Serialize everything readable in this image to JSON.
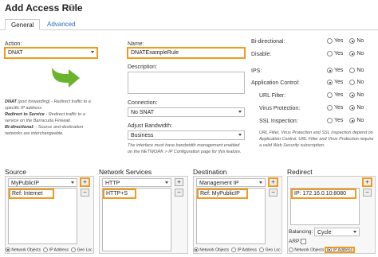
{
  "header": {
    "title": "Add Access Rule",
    "help_icon": "?"
  },
  "tabs": [
    {
      "label": "General"
    },
    {
      "label": "Advanced"
    }
  ],
  "action": {
    "label": "Action:",
    "value": "DNAT",
    "help": {
      "dnat_term": "DNAT",
      "dnat_desc": "(port forwarding) - Redirect traffic to a specific IP address.",
      "redirect_term": "Redirect to Service",
      "redirect_desc": " - Redirect traffic to a service on the Barracuda Firewall.",
      "bidi_term": "Bi-directional:",
      "bidi_desc": " - Source and destination networks are interchangeable."
    },
    "arrow_color": "#6ab42d"
  },
  "name": {
    "label": "Name:",
    "value": "DNATExampleRule"
  },
  "description": {
    "label": "Description:"
  },
  "connection": {
    "label": "Connection:",
    "value": "No SNAT"
  },
  "bandwidth": {
    "label": "Adjust Bandwidth:",
    "value": "Business",
    "help": "The interface must have bandwidth management enabled on the NETWORK > IP Configuration page for this feature."
  },
  "options": {
    "bidirectional": {
      "label": "Bi-directional:",
      "yes": "Yes",
      "no": "No",
      "selected": "no"
    },
    "disable": {
      "label": "Disable:",
      "yes": "Yes",
      "no": "No",
      "selected": "no"
    },
    "ips": {
      "label": "IPS:",
      "yes": "Yes",
      "no": "No",
      "selected": "yes"
    },
    "app_control": {
      "label": "Application Control:",
      "yes": "Yes",
      "no": "No",
      "selected": "yes"
    },
    "url_filter": {
      "label": "URL Filter:",
      "yes": "Yes",
      "no": "No",
      "selected": "no"
    },
    "virus_protection": {
      "label": "Virus Protection:",
      "yes": "Yes",
      "no": "No",
      "selected": "no"
    },
    "ssl_inspection": {
      "label": "SSL Inspection:",
      "yes": "Yes",
      "no": "No",
      "selected": "no"
    },
    "note": "URL Filter, Virus Protection and SSL Inspection depend on Application Control. URL Filter and Virus Protection require a valid Web Security subscription."
  },
  "source": {
    "title": "Source",
    "select_value": "MyPublicIP",
    "list": [
      "Ref: Internet"
    ],
    "footer": [
      "Network Objects",
      "IP Address",
      "Geo Loc"
    ]
  },
  "services": {
    "title": "Network Services",
    "select_value": "HTTP",
    "list": [
      "HTTP+S"
    ]
  },
  "destination": {
    "title": "Destination",
    "select_value": "Management IP",
    "list": [
      "Ref: MyPublicIP"
    ],
    "footer": [
      "Network Objects",
      "IP Address",
      "Geo Loc"
    ]
  },
  "redirect": {
    "title": "Redirect",
    "list": [
      "IP: 172.16.0.10:8080"
    ],
    "balancing_label": "Balancing:",
    "balancing_value": "Cycle",
    "arp_label": "ARP:",
    "footer": [
      "Network Objects",
      "IP Address"
    ]
  },
  "buttons": {
    "add": "+",
    "remove": "−"
  },
  "colors": {
    "highlight": "#f39a1e",
    "link": "#2a6ebb"
  }
}
